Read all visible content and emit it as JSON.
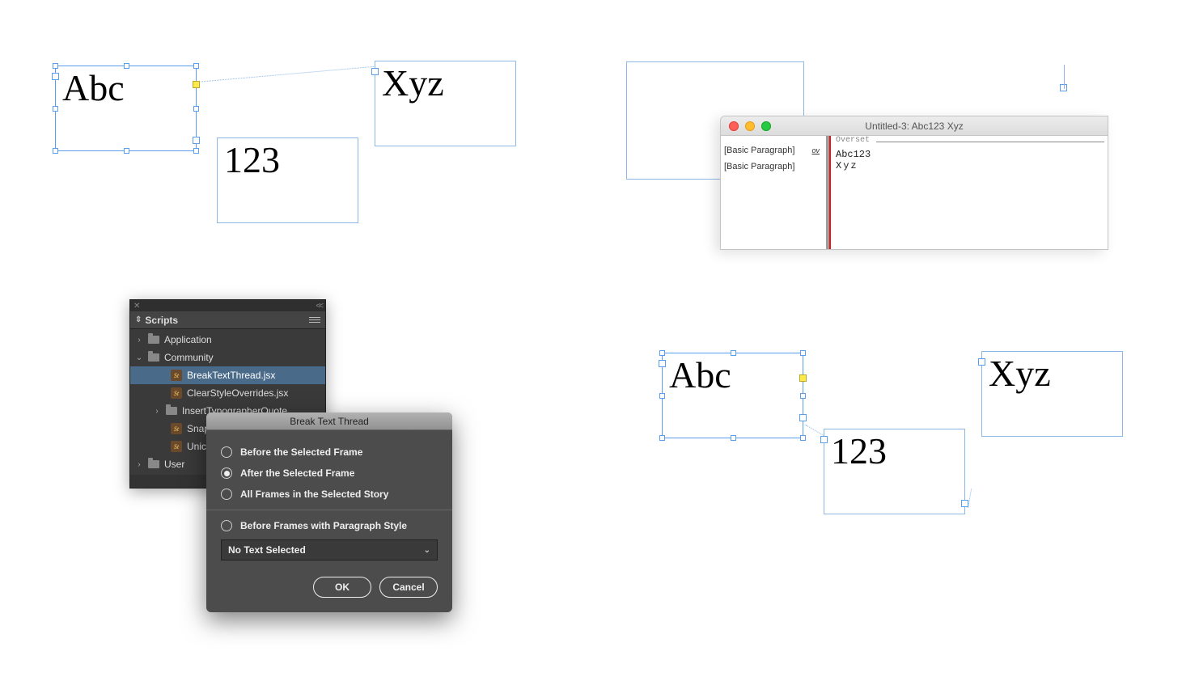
{
  "q1": {
    "frame_a": "Abc",
    "frame_b": "123",
    "frame_c": "Xyz"
  },
  "q2": {
    "window_title": "Untitled-3: Abc123 Xyz",
    "rows": [
      {
        "style": "[Basic Paragraph]",
        "override": "ov",
        "text": "Abc123"
      },
      {
        "style": "[Basic Paragraph]",
        "override": "",
        "text": "Xyz"
      }
    ],
    "overset_label": "Overset"
  },
  "q3": {
    "panel_title": "Scripts",
    "folders": {
      "application": "Application",
      "community": "Community",
      "user": "User"
    },
    "scripts": [
      "BreakTextThread.jsx",
      "ClearStyleOverrides.jsx",
      "InsertTypographerQuote",
      "Snap",
      "Unic"
    ],
    "dialog": {
      "title": "Break Text Thread",
      "options": [
        "Before the Selected Frame",
        "After the Selected Frame",
        "All Frames in the Selected Story",
        "Before Frames with Paragraph Style"
      ],
      "selected_index": 1,
      "dropdown_value": "No Text Selected",
      "ok": "OK",
      "cancel": "Cancel"
    }
  },
  "q4": {
    "frame_a": "Abc",
    "frame_b": "123",
    "frame_c": "Xyz"
  }
}
